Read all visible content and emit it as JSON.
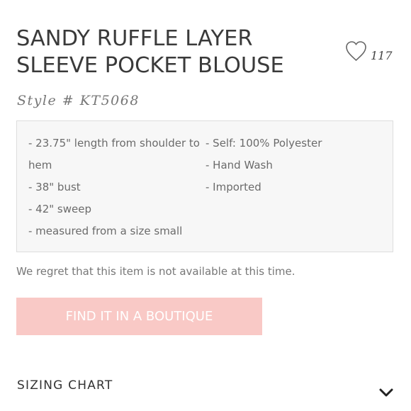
{
  "product": {
    "title": "SANDY RUFFLE LAYER SLEEVE POCKET BLOUSE",
    "style_number": "Style # KT5068",
    "favorite_count": "117"
  },
  "details": {
    "left": [
      "- 23.75\" length from shoulder to hem",
      "- 38\" bust",
      "- 42\" sweep",
      "- measured from a size small"
    ],
    "right": [
      "- Self: 100% Polyester",
      "- Hand Wash",
      "- Imported"
    ]
  },
  "availability_notice": "We regret that this item is not available at this time.",
  "cta": {
    "label": "FIND IT IN A BOUTIQUE",
    "color": "#f9c9c6"
  },
  "sizing_chart": {
    "label": "SIZING CHART",
    "icon": "chevron-down-icon"
  },
  "icons": {
    "favorite": "heart-outline-icon"
  }
}
